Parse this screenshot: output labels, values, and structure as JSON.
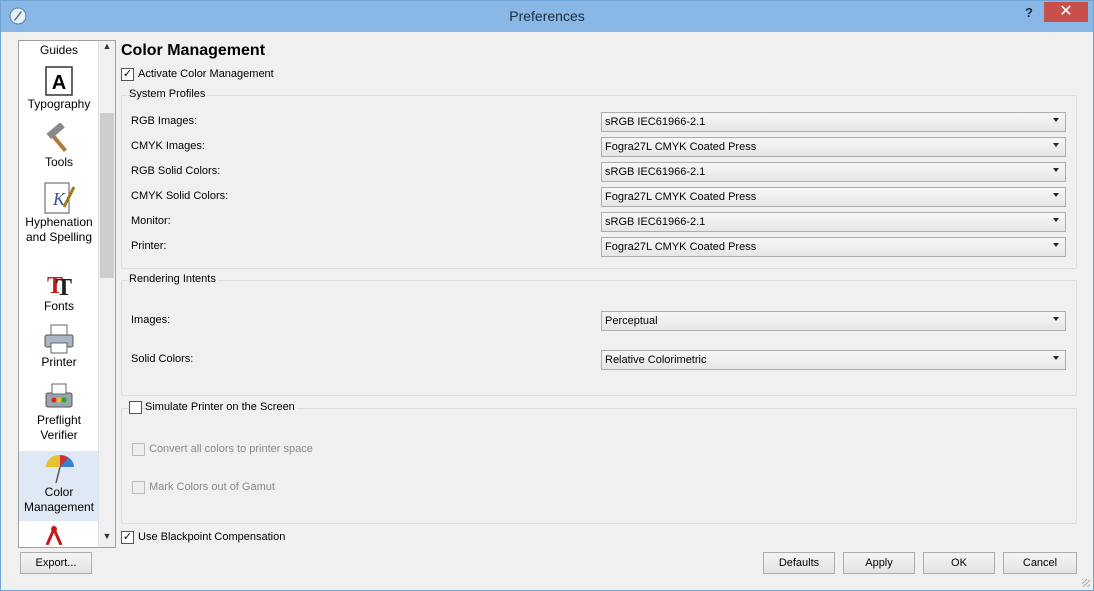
{
  "window": {
    "title": "Preferences",
    "help": "?",
    "close": "✕"
  },
  "sidebar": {
    "items": [
      {
        "label": "Guides",
        "icon": "guides-icon"
      },
      {
        "label": "Typography",
        "icon": "typography-icon"
      },
      {
        "label": "Tools",
        "icon": "tools-icon"
      },
      {
        "label": "Hyphenation\nand Spelling",
        "icon": "hyphenation-icon"
      },
      {
        "label": "Fonts",
        "icon": "fonts-icon"
      },
      {
        "label": "Printer",
        "icon": "printer-icon"
      },
      {
        "label": "Preflight\nVerifier",
        "icon": "preflight-icon"
      },
      {
        "label": "Color\nManagement",
        "icon": "color-management-icon",
        "selected": true
      }
    ]
  },
  "main": {
    "heading": "Color Management",
    "activate_label": "Activate Color Management",
    "activate_checked": true,
    "system_profiles": {
      "title": "System Profiles",
      "rows": [
        {
          "label": "RGB Images:",
          "value": "sRGB IEC61966-2.1"
        },
        {
          "label": "CMYK Images:",
          "value": "Fogra27L CMYK Coated Press"
        },
        {
          "label": "RGB Solid Colors:",
          "value": "sRGB IEC61966-2.1"
        },
        {
          "label": "CMYK Solid Colors:",
          "value": "Fogra27L CMYK Coated Press"
        },
        {
          "label": "Monitor:",
          "value": "sRGB IEC61966-2.1"
        },
        {
          "label": "Printer:",
          "value": "Fogra27L CMYK Coated Press"
        }
      ]
    },
    "rendering_intents": {
      "title": "Rendering Intents",
      "rows": [
        {
          "label": "Images:",
          "value": "Perceptual"
        },
        {
          "label": "Solid Colors:",
          "value": "Relative Colorimetric"
        }
      ]
    },
    "simulate_label": "Simulate Printer on the Screen",
    "convert_label": "Convert all colors to printer space",
    "gamut_label": "Mark Colors out of Gamut",
    "blackpoint_label": "Use Blackpoint Compensation",
    "blackpoint_checked": true
  },
  "buttons": {
    "export": "Export...",
    "defaults": "Defaults",
    "apply": "Apply",
    "ok": "OK",
    "cancel": "Cancel"
  },
  "colors": {
    "titlebar": "#8ab8e6",
    "close": "#c7504a",
    "selected": "#dfe9f5"
  }
}
